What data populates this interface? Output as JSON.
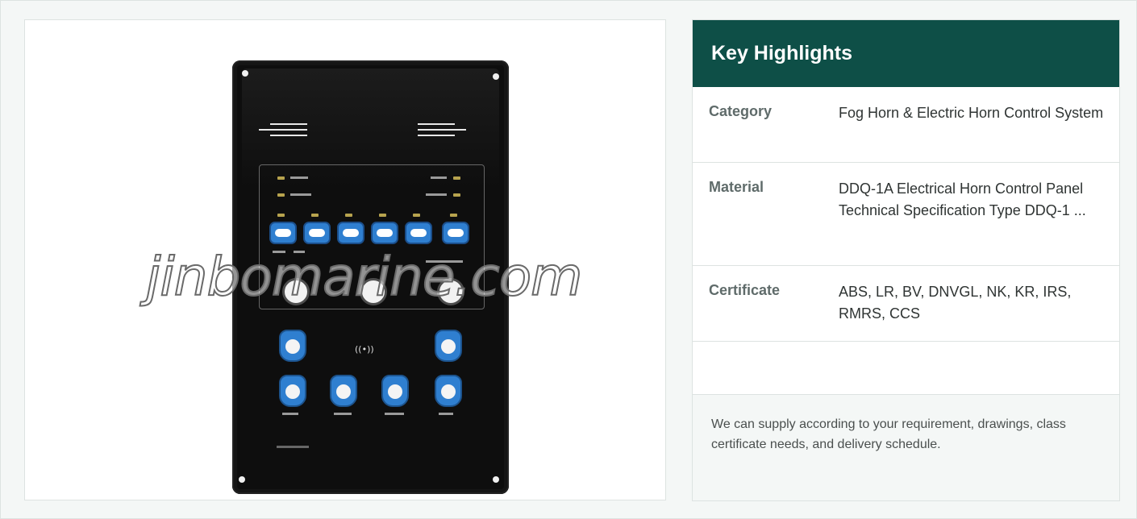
{
  "product": {
    "watermark": "jinbomarine.com",
    "image_alt": "DDQ-1A Electrical Horn Control Panel"
  },
  "highlights": {
    "title": "Key Highlights",
    "rows": [
      {
        "label": "Category",
        "value": "Fog Horn & Electric Horn Control System"
      },
      {
        "label": "Material",
        "value": "DDQ-1A Electrical Horn Control Panel Technical Specification Type DDQ-1 ..."
      },
      {
        "label": "Certificate",
        "value": "ABS, LR, BV, DNVGL, NK, KR, IRS, RMRS, CCS"
      },
      {
        "label": "",
        "value": ""
      }
    ],
    "note": "We can supply according to your requirement, drawings, class certificate needs, and delivery schedule."
  },
  "colors": {
    "header_bg": "#0e4f47",
    "page_bg": "#f4f7f6",
    "switch_blue": "#2f7fd0"
  }
}
